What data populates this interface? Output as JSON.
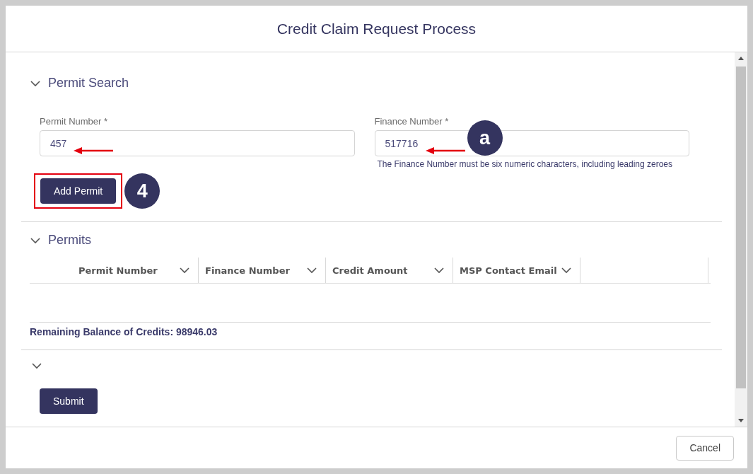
{
  "window": {
    "title": "Credit Claim Request Process"
  },
  "permit_search": {
    "title": "Permit Search",
    "expanded": true,
    "fields": [
      {
        "label": "Permit Number *",
        "value": "457",
        "arrow": true
      },
      {
        "label": "Finance Number *",
        "value": "517716",
        "arrow": true,
        "callout": "a",
        "hint": "The Finance Number must be six numeric characters, including leading zeroes"
      }
    ],
    "add_button": {
      "label": "Add Permit",
      "highlighted": true,
      "callout": "4"
    }
  },
  "permits": {
    "title": "Permits",
    "expanded": true,
    "columns": [
      {
        "label": "Permit Number"
      },
      {
        "label": "Finance Number"
      },
      {
        "label": "Credit Amount"
      },
      {
        "label": "MSP Contact Email"
      }
    ],
    "balance": "Remaining Balance of Credits: 98946.03"
  },
  "details": {
    "expanded": true
  },
  "submit": "Submit",
  "footer": {
    "cancel": "Cancel"
  }
}
